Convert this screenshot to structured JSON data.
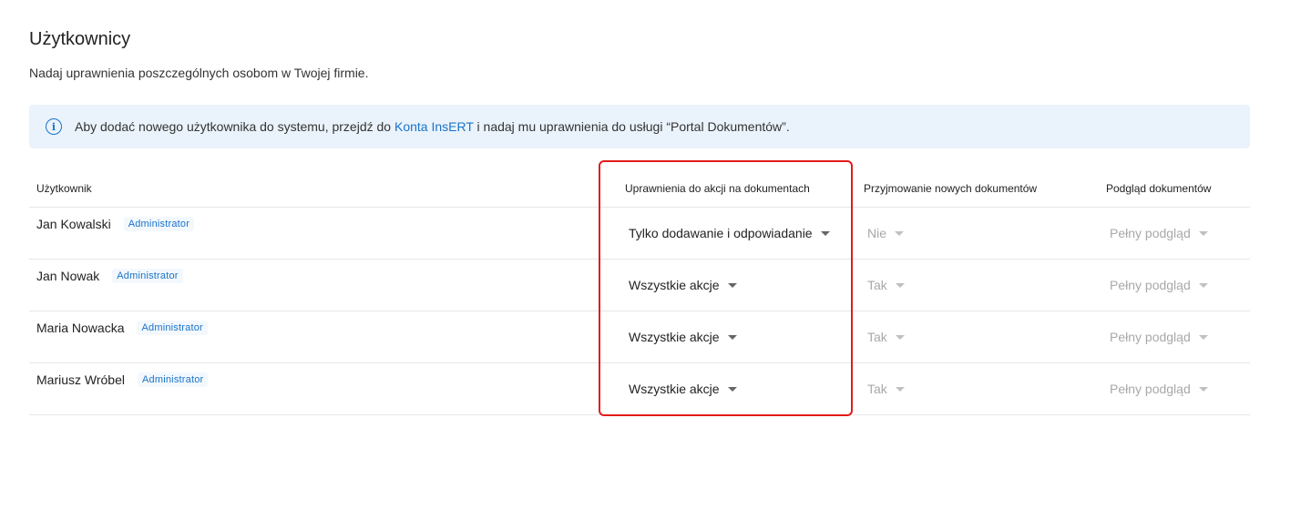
{
  "page": {
    "title": "Użytkownicy",
    "subtitle": "Nadaj uprawnienia poszczególnych osobom w Twojej firmie."
  },
  "info": {
    "icon": "info-icon",
    "text_before": "Aby dodać nowego użytkownika do systemu, przejdź do ",
    "link_text": "Konta InsERT",
    "text_after": " i nadaj mu uprawnienia do usługi “Portal Dokumentów”."
  },
  "table": {
    "headers": {
      "user": "Użytkownik",
      "actions": "Uprawnienia do akcji na dokumentach",
      "accept": "Przyjmowanie nowych dokumentów",
      "preview": "Podgląd dokumentów"
    },
    "rows": [
      {
        "name": "Jan Kowalski",
        "role": "Administrator",
        "actions": "Tylko dodawanie i odpowiadanie",
        "accept": "Nie",
        "preview": "Pełny podgląd"
      },
      {
        "name": "Jan Nowak",
        "role": "Administrator",
        "actions": "Wszystkie akcje",
        "accept": "Tak",
        "preview": "Pełny podgląd"
      },
      {
        "name": "Maria Nowacka",
        "role": "Administrator",
        "actions": "Wszystkie akcje",
        "accept": "Tak",
        "preview": "Pełny podgląd"
      },
      {
        "name": "Mariusz Wróbel",
        "role": "Administrator",
        "actions": "Wszystkie akcje",
        "accept": "Tak",
        "preview": "Pełny podgląd"
      }
    ]
  },
  "colors": {
    "accent": "#1a73c8",
    "highlight_border": "#e31b1b",
    "info_background": "#eaf3fb"
  }
}
